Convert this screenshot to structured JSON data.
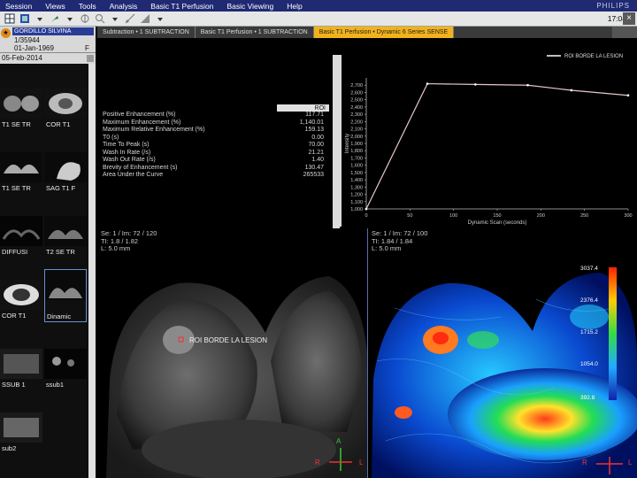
{
  "menubar": {
    "items": [
      "Session",
      "Views",
      "Tools",
      "Analysis",
      "Basic T1 Perfusion",
      "Basic Viewing",
      "Help"
    ],
    "brand": "PHILIPS"
  },
  "toolbar": {
    "clock": "17:04"
  },
  "patient": {
    "name": "GORDILLO SILVINA",
    "id": "1/35944",
    "dob": "01-Jan-1969",
    "sex": "F"
  },
  "tabs": [
    {
      "label": "Subtraction • 1 SUBTRACTION",
      "active": false
    },
    {
      "label": "Basic T1 Perfusion • 1 SUBTRACTION",
      "active": false
    },
    {
      "label": "Basic T1 Perfusion • Dynamic 6 Series SENSE",
      "active": true
    }
  ],
  "series": {
    "date": "05-Feb-2014",
    "thumbs": [
      {
        "label": "T1 SE TR",
        "selected": false
      },
      {
        "label": "COR T1",
        "selected": false
      },
      {
        "label": "T1 SE TR",
        "selected": false
      },
      {
        "label": "SAG T1 F",
        "selected": false
      },
      {
        "label": "DIFFUSI",
        "selected": false
      },
      {
        "label": "T2 SE TR",
        "selected": false
      },
      {
        "label": "COR T1",
        "selected": false
      },
      {
        "label": "Dinamic",
        "selected": true
      },
      {
        "label": "SSUB 1",
        "selected": false
      },
      {
        "label": "ssub1",
        "selected": false
      },
      {
        "label": "sub2",
        "selected": false
      }
    ]
  },
  "results": {
    "column_header": "ROI",
    "rows": [
      {
        "label": "Positive Enhancement (%)",
        "value": "117.71"
      },
      {
        "label": "Maximum Enhancement (%)",
        "value": "1,140.01"
      },
      {
        "label": "Maximum Relative Enhancement (%)",
        "value": "159.13"
      },
      {
        "label": "T0 (s)",
        "value": "0.00"
      },
      {
        "label": "Time To Peak (s)",
        "value": "70.00"
      },
      {
        "label": "Wash In Rate (/s)",
        "value": "21.21"
      },
      {
        "label": "Wash Out Rate (/s)",
        "value": "1.40"
      },
      {
        "label": "Brevity of Enhancement (s)",
        "value": "130.47"
      },
      {
        "label": "Area Under the Curve",
        "value": "265533"
      }
    ]
  },
  "chart_data": {
    "type": "line",
    "title": "",
    "xlabel": "Dynamic Scan (seconds)",
    "ylabel": "Intensity",
    "xlim": [
      0,
      300
    ],
    "ylim": [
      1000,
      2800
    ],
    "xticks": [
      0,
      50,
      100,
      150,
      200,
      250,
      300
    ],
    "yticks": [
      1000,
      1100,
      1200,
      1300,
      1400,
      1500,
      1600,
      1700,
      1800,
      1900,
      2000,
      2100,
      2200,
      2300,
      2400,
      2500,
      2600,
      2700
    ],
    "series": [
      {
        "name": "ROI BORDE LA LESION",
        "color": "#ffffff",
        "x": [
          0,
          70,
          125,
          185,
          235,
          300
        ],
        "y": [
          1000,
          2720,
          2710,
          2700,
          2630,
          2560
        ]
      }
    ],
    "legend_position": "top-right",
    "grid": false
  },
  "viewport_left": {
    "info": [
      "Se: 1 / Im: 72 / 120",
      "TI: 1.8 / 1.82",
      "L: 5.0 mm"
    ],
    "roi_label": "ROI BORDE LA LESION",
    "orient_top": "A",
    "orient_left": "R",
    "orient_right": "L"
  },
  "viewport_right": {
    "info": [
      "Se: 1 / Im: 72 / 100",
      "TI: 1.84 / 1.84",
      "L: 5.0 mm"
    ],
    "colorbar_labels": [
      "3037.4",
      "2376.4",
      "1715.2",
      "1054.0",
      "392.8"
    ],
    "orient_left": "R",
    "orient_right": "L"
  }
}
